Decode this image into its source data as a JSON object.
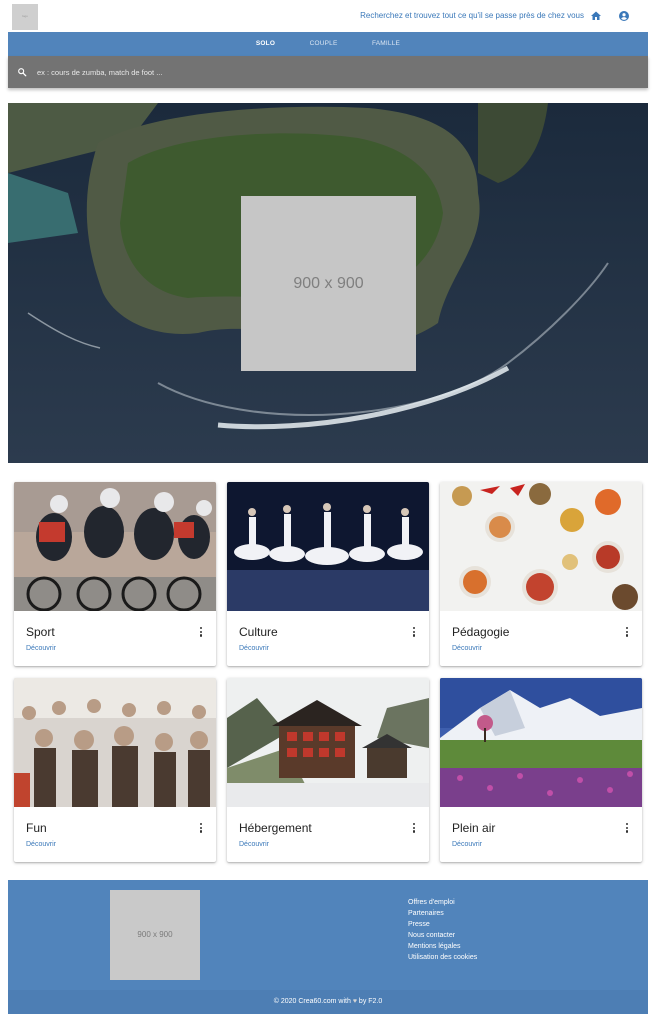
{
  "header": {
    "logo_text": "logo",
    "tagline": "Recherchez et trouvez tout ce qu'il se passe près de chez vous",
    "home_icon": "home-icon",
    "account_icon": "account-circle-icon"
  },
  "tabs": [
    {
      "label": "SOLO",
      "active": true
    },
    {
      "label": "COUPLE",
      "active": false
    },
    {
      "label": "FAMILLE",
      "active": false
    }
  ],
  "search": {
    "placeholder": "ex : cours de zumba, match de foot ...",
    "value": "",
    "icon": "search-icon"
  },
  "hero": {
    "placeholder_label": "900 x 900"
  },
  "categories": [
    {
      "title": "Sport",
      "link": "Découvrir",
      "image": "cyclists racing"
    },
    {
      "title": "Culture",
      "link": "Découvrir",
      "image": "ballet dancers on stage"
    },
    {
      "title": "Pédagogie",
      "link": "Découvrir",
      "image": "spices in bowls"
    },
    {
      "title": "Fun",
      "link": "Découvrir",
      "image": "festival crowd"
    },
    {
      "title": "Hébergement",
      "link": "Découvrir",
      "image": "mountain chalet"
    },
    {
      "title": "Plein air",
      "link": "Découvrir",
      "image": "flower meadow with mountains"
    }
  ],
  "footer": {
    "placeholder_label": "900 x 900",
    "links": [
      "Offres d'emploi",
      "Partenaires",
      "Presse",
      "Nous contacter",
      "Mentions légales",
      "Utilisation des cookies"
    ],
    "copyright_prefix": "© 2020 Crea60.com with",
    "heart": "♥",
    "copyright_suffix": "by F2.0"
  },
  "colors": {
    "primary": "#5184bb",
    "link": "#3a78b9",
    "search_bar": "#737373"
  }
}
